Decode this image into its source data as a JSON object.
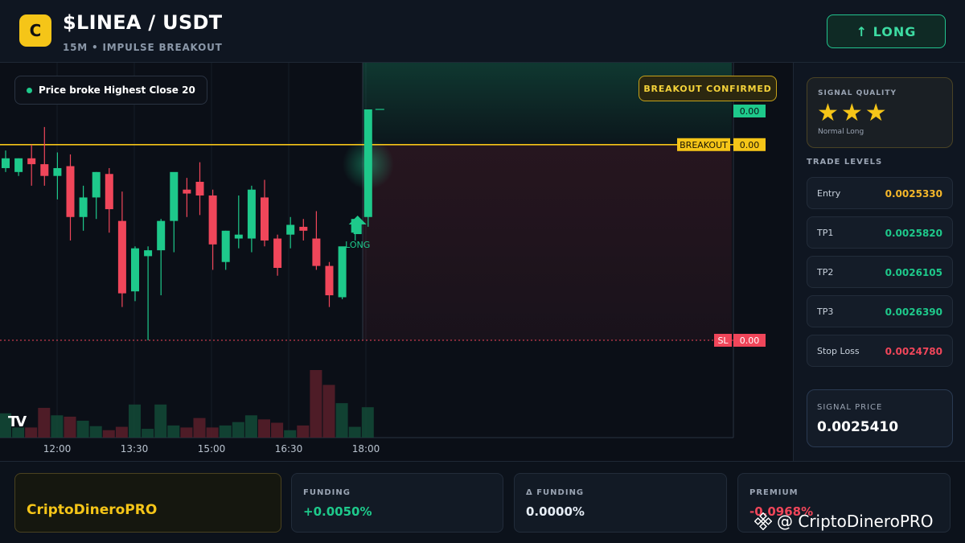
{
  "header": {
    "logo_letter": "C",
    "title": "$LINEA / USDT",
    "subtitle": "15M • IMPULSE BREAKOUT",
    "long_button": "↑ LONG"
  },
  "chart": {
    "info_pill": "Price broke Highest Close 20",
    "confirm_pill": "BREAKOUT CONFIRMED",
    "tv_logo": "TV",
    "long_marker": "LONG",
    "breakout_label": "BREAKOUT",
    "sl_label": "SL",
    "tp_price_label": "0.00",
    "breakout_price_label": "0.00",
    "sl_price_label": "0.00"
  },
  "colors": {
    "bull": "#1ec98b",
    "bear": "#f0465a",
    "breakout": "#f5c518",
    "stop": "#f0465a"
  },
  "chart_data": {
    "type": "candlestick",
    "x_ticks": [
      "12:00",
      "13:30",
      "15:00",
      "16:30",
      "18:00"
    ],
    "breakout_level": 1.0,
    "stop_level": 0.0,
    "candles": [
      {
        "o": 0.88,
        "h": 0.97,
        "l": 0.86,
        "c": 0.93
      },
      {
        "o": 0.86,
        "h": 0.93,
        "l": 0.84,
        "c": 0.93
      },
      {
        "o": 0.93,
        "h": 1.0,
        "l": 0.79,
        "c": 0.9
      },
      {
        "o": 0.9,
        "h": 1.09,
        "l": 0.79,
        "c": 0.84
      },
      {
        "o": 0.84,
        "h": 0.96,
        "l": 0.72,
        "c": 0.88
      },
      {
        "o": 0.89,
        "h": 0.95,
        "l": 0.51,
        "c": 0.63
      },
      {
        "o": 0.63,
        "h": 0.79,
        "l": 0.56,
        "c": 0.73
      },
      {
        "o": 0.73,
        "h": 0.86,
        "l": 0.62,
        "c": 0.86
      },
      {
        "o": 0.85,
        "h": 0.88,
        "l": 0.55,
        "c": 0.67
      },
      {
        "o": 0.61,
        "h": 0.76,
        "l": 0.17,
        "c": 0.24
      },
      {
        "o": 0.25,
        "h": 0.48,
        "l": 0.2,
        "c": 0.47
      },
      {
        "o": 0.43,
        "h": 0.48,
        "l": 0.0,
        "c": 0.46
      },
      {
        "o": 0.46,
        "h": 0.62,
        "l": 0.23,
        "c": 0.61
      },
      {
        "o": 0.61,
        "h": 0.85,
        "l": 0.45,
        "c": 0.86
      },
      {
        "o": 0.77,
        "h": 0.83,
        "l": 0.63,
        "c": 0.75
      },
      {
        "o": 0.81,
        "h": 0.91,
        "l": 0.64,
        "c": 0.74
      },
      {
        "o": 0.74,
        "h": 0.77,
        "l": 0.36,
        "c": 0.49
      },
      {
        "o": 0.4,
        "h": 0.56,
        "l": 0.36,
        "c": 0.56
      },
      {
        "o": 0.52,
        "h": 0.74,
        "l": 0.47,
        "c": 0.54
      },
      {
        "o": 0.52,
        "h": 0.79,
        "l": 0.45,
        "c": 0.77
      },
      {
        "o": 0.73,
        "h": 0.82,
        "l": 0.48,
        "c": 0.51
      },
      {
        "o": 0.52,
        "h": 0.54,
        "l": 0.33,
        "c": 0.37
      },
      {
        "o": 0.54,
        "h": 0.63,
        "l": 0.47,
        "c": 0.59
      },
      {
        "o": 0.58,
        "h": 0.62,
        "l": 0.51,
        "c": 0.56
      },
      {
        "o": 0.52,
        "h": 0.66,
        "l": 0.36,
        "c": 0.38
      },
      {
        "o": 0.38,
        "h": 0.4,
        "l": 0.17,
        "c": 0.23
      },
      {
        "o": 0.22,
        "h": 0.47,
        "l": 0.21,
        "c": 0.48
      },
      {
        "o": 0.55,
        "h": 0.62,
        "l": 0.51,
        "c": 0.62
      },
      {
        "o": 0.63,
        "h": 1.18,
        "l": 0.58,
        "c": 1.18
      }
    ],
    "volumes": [
      0.36,
      0.15,
      0.15,
      0.44,
      0.33,
      0.31,
      0.25,
      0.17,
      0.11,
      0.16,
      0.49,
      0.13,
      0.49,
      0.18,
      0.15,
      0.29,
      0.15,
      0.18,
      0.23,
      0.33,
      0.27,
      0.22,
      0.11,
      0.18,
      1.0,
      0.78,
      0.51,
      0.16,
      0.45
    ]
  },
  "sidebar": {
    "quality_label": "SIGNAL QUALITY",
    "stars": "★★★",
    "stars_rating": 3,
    "quality_note": "Normal Long",
    "levels_title": "TRADE LEVELS",
    "levels": [
      {
        "label": "Entry",
        "value": "0.0025330",
        "color": "#f5b72a"
      },
      {
        "label": "TP1",
        "value": "0.0025820",
        "color": "#1ec98b"
      },
      {
        "label": "TP2",
        "value": "0.0026105",
        "color": "#1ec98b"
      },
      {
        "label": "TP3",
        "value": "0.0026390",
        "color": "#1ec98b"
      },
      {
        "label": "Stop Loss",
        "value": "0.0024780",
        "color": "#f0465a"
      }
    ],
    "signal_price_label": "SIGNAL PRICE",
    "signal_price": "0.0025410"
  },
  "bottom": {
    "brand": "CriptoDineroPRO",
    "stats": [
      {
        "label": "FUNDING",
        "value": "+0.0050%",
        "color": "#1ec98b"
      },
      {
        "label": "Δ FUNDING",
        "value": "0.0000%",
        "color": "#e6edf5"
      },
      {
        "label": "PREMIUM",
        "value": "-0.0968%",
        "color": "#f0465a"
      }
    ],
    "watermark": "@ CriptoDineroPRO"
  }
}
